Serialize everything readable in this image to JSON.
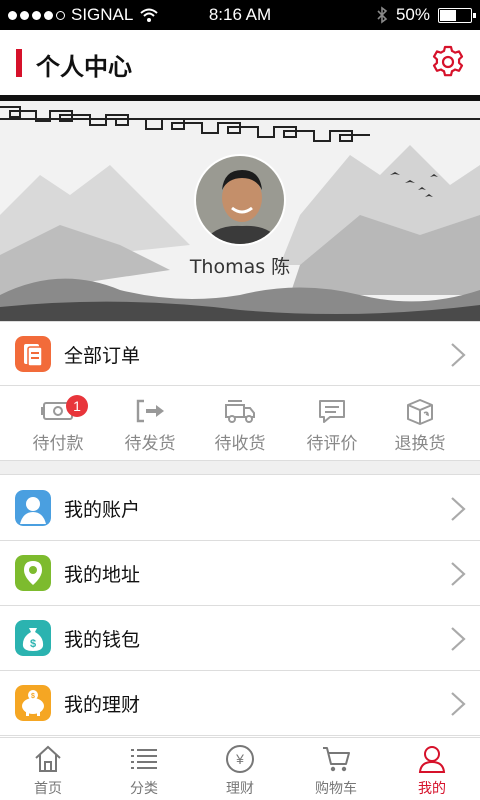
{
  "status_bar": {
    "carrier": "SIGNAL",
    "time": "8:16 AM",
    "battery": "50%",
    "battery_level": 0.5
  },
  "header": {
    "title": "个人中心",
    "settings_icon": "gear-icon",
    "accent_color": "#d6112a"
  },
  "profile": {
    "name": "Thomas 陈"
  },
  "all_orders": {
    "label": "全部订单",
    "icon": "document-icon",
    "icon_color": "#f26b3a"
  },
  "order_status": [
    {
      "label": "待付款",
      "icon": "cash-icon",
      "badge": "1"
    },
    {
      "label": "待发货",
      "icon": "ship-out-icon"
    },
    {
      "label": "待收货",
      "icon": "truck-icon"
    },
    {
      "label": "待评价",
      "icon": "comment-icon"
    },
    {
      "label": "退换货",
      "icon": "return-box-icon"
    }
  ],
  "menu": [
    {
      "label": "我的账户",
      "icon": "user-icon",
      "color": "#4a9fe0"
    },
    {
      "label": "我的地址",
      "icon": "location-icon",
      "color": "#7dbb2e"
    },
    {
      "label": "我的钱包",
      "icon": "money-bag-icon",
      "color": "#2bb3b0"
    },
    {
      "label": "我的理财",
      "icon": "piggy-bank-icon",
      "color": "#f5a623"
    }
  ],
  "tab_bar": [
    {
      "label": "首页",
      "icon": "home-icon"
    },
    {
      "label": "分类",
      "icon": "list-icon"
    },
    {
      "label": "理财",
      "icon": "yen-icon"
    },
    {
      "label": "购物车",
      "icon": "cart-icon"
    },
    {
      "label": "我的",
      "icon": "person-icon",
      "active": true
    }
  ]
}
